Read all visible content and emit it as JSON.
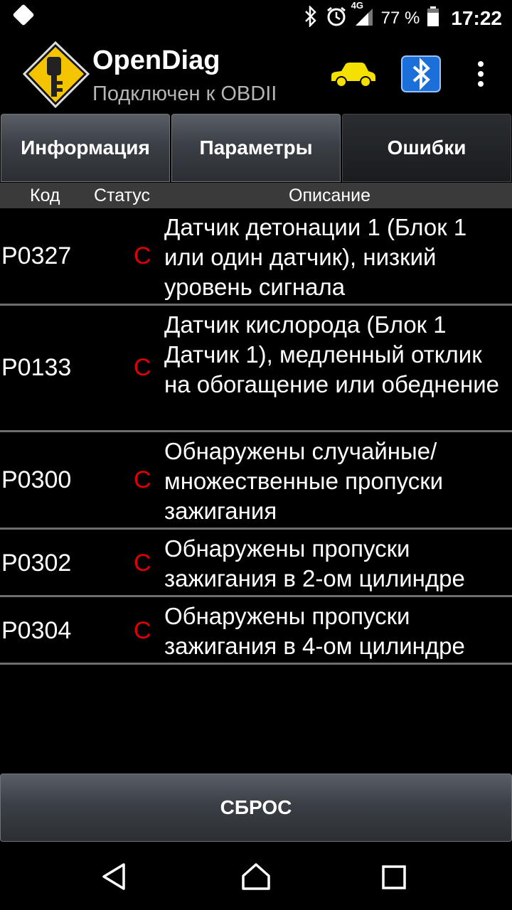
{
  "status_bar": {
    "network": "4G",
    "battery": "77 %",
    "time": "17:22"
  },
  "app": {
    "title": "OpenDiag",
    "subtitle": "Подключен к OBDII"
  },
  "tabs": [
    {
      "label": "Информация"
    },
    {
      "label": "Параметры"
    },
    {
      "label": "Ошибки"
    }
  ],
  "columns": {
    "code": "Код",
    "status": "Статус",
    "description": "Описание"
  },
  "errors": [
    {
      "code": "P0327",
      "status": "C",
      "description": "Датчик детонации 1 (Блок 1 или один датчик), низкий уровень сигнала"
    },
    {
      "code": "P0133",
      "status": "C",
      "description": "Датчик кислорода (Блок 1 Датчик 1), медленный отклик на обогащение или обеднение"
    },
    {
      "code": "P0300",
      "status": "C",
      "description": "Обнаружены случайные/ множественные пропуски зажигания"
    },
    {
      "code": "P0302",
      "status": "C",
      "description": "Обнаружены пропуски зажигания в 2-ом цилиндре"
    },
    {
      "code": "P0304",
      "status": "C",
      "description": "Обнаружены пропуски зажигания в 4-ом цилиндре"
    }
  ],
  "reset_label": "СБРОС",
  "colors": {
    "status_red": "#e00000",
    "car_yellow": "#f5e000",
    "bt_blue": "#1a6fd8"
  }
}
